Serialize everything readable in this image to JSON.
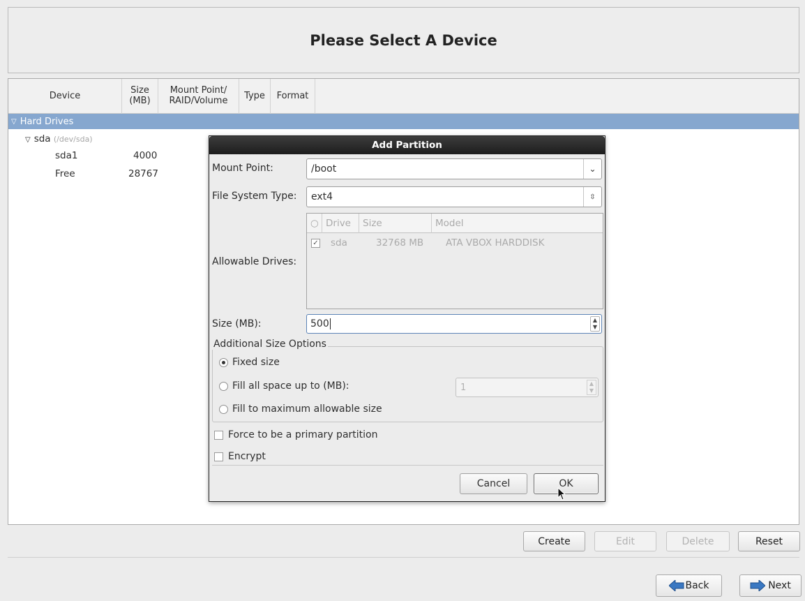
{
  "header": {
    "title": "Please Select A Device"
  },
  "tree": {
    "columns": [
      {
        "label": "Device"
      },
      {
        "label": "Size\n(MB)"
      },
      {
        "label": "Mount Point/\nRAID/Volume"
      },
      {
        "label": "Type"
      },
      {
        "label": "Format"
      }
    ],
    "group_label": "Hard Drives",
    "disk": {
      "name": "sda",
      "path": "(/dev/sda)"
    },
    "rows": [
      {
        "device": "sda1",
        "size": "4000"
      },
      {
        "device": "Free",
        "size": "28767"
      }
    ]
  },
  "dialog": {
    "title": "Add Partition",
    "mount_point_label": "Mount Point:",
    "mount_point_value": "/boot",
    "fs_type_label": "File System Type:",
    "fs_type_value": "ext4",
    "allowable_drives_label": "Allowable Drives:",
    "drives_headers": {
      "radio": "○",
      "drive": "Drive",
      "size": "Size",
      "model": "Model"
    },
    "drive_row": {
      "checked": true,
      "drive": "sda",
      "size": "32768 MB",
      "model": "ATA VBOX HARDDISK"
    },
    "size_label": "Size (MB):",
    "size_value": "500",
    "size_options_legend": "Additional Size Options",
    "options": [
      {
        "label": "Fixed size",
        "selected": true
      },
      {
        "label": "Fill all space up to (MB):",
        "selected": false
      },
      {
        "label": "Fill to maximum allowable size",
        "selected": false
      }
    ],
    "fill_value": "1",
    "force_primary_label": "Force to be a primary partition",
    "encrypt_label": "Encrypt",
    "cancel_label": "Cancel",
    "ok_label": "OK"
  },
  "actions": {
    "create": "Create",
    "edit": "Edit",
    "delete": "Delete",
    "reset": "Reset"
  },
  "nav": {
    "back": "Back",
    "next": "Next"
  },
  "colors": {
    "selection": "#86a7cf",
    "title_bar": "#2a2a2a",
    "nav_arrow": "#3a78c2"
  }
}
